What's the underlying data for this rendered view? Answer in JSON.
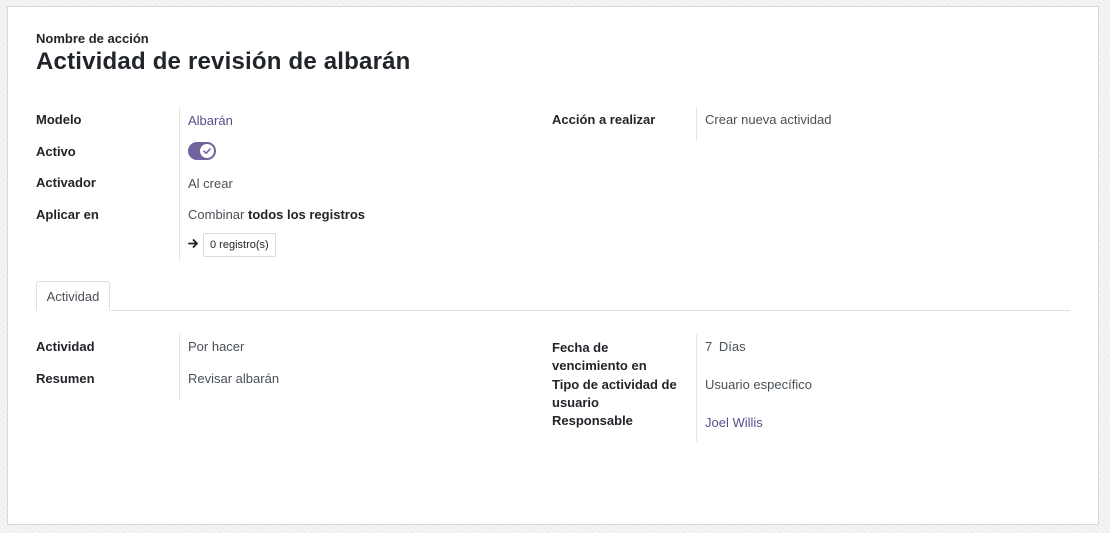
{
  "header": {
    "name_label": "Nombre de acción",
    "title": "Actividad de revisión de albarán"
  },
  "top": {
    "model_label": "Modelo",
    "model_value": "Albarán",
    "active_label": "Activo",
    "active_value": true,
    "trigger_label": "Activador",
    "trigger_value": "Al crear",
    "apply_label": "Aplicar en",
    "apply_prefix": "Combinar",
    "apply_bold": "todos los registros",
    "records_button": "0 registro(s)",
    "action_label": "Acción a realizar",
    "action_value": "Crear nueva actividad"
  },
  "tabs": [
    {
      "label": "Actividad",
      "active": true
    }
  ],
  "activity": {
    "activity_label": "Actividad",
    "activity_value": "Por hacer",
    "summary_label": "Resumen",
    "summary_value": "Revisar albarán",
    "due_label_line1": "Fecha de",
    "due_label_line2": "vencimiento en",
    "due_number": "7",
    "due_unit": "Días",
    "user_type_label_line1": "Tipo de actividad de",
    "user_type_label_line2": "usuario",
    "user_type_value": "Usuario específico",
    "responsible_label": "Responsable",
    "responsible_value": "Joel Willis"
  },
  "colors": {
    "accent": "#71639e",
    "link": "#5b4d8a"
  }
}
